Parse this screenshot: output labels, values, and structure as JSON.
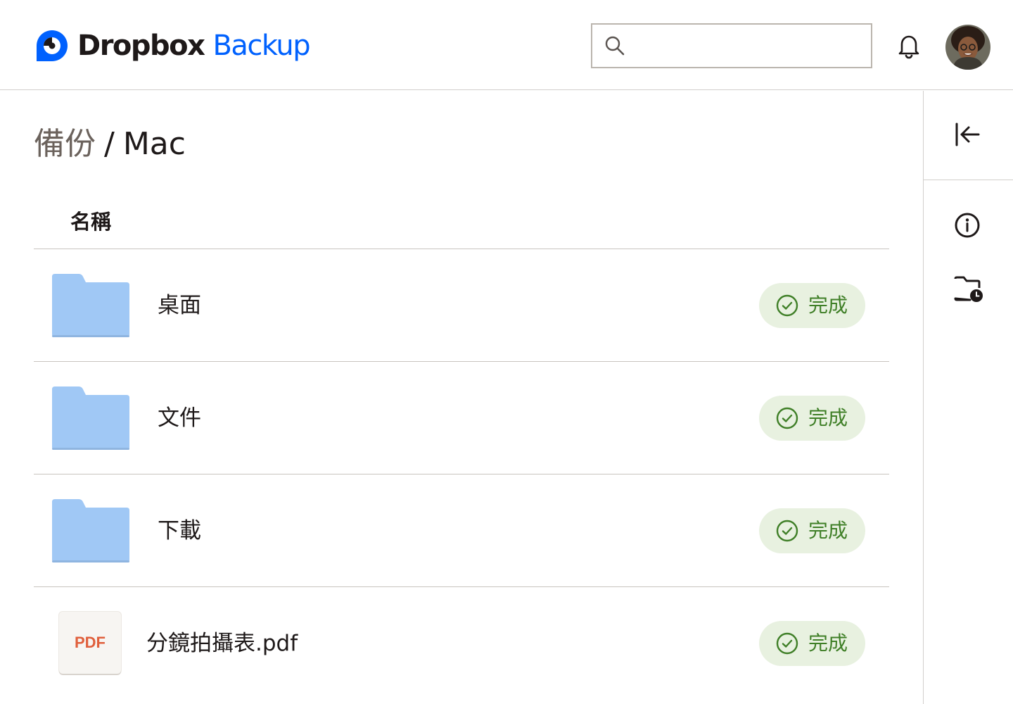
{
  "header": {
    "brand": "Dropbox",
    "product": "Backup",
    "search": {
      "value": "",
      "placeholder": ""
    },
    "icons": {
      "logo": "dropbox-logo-icon",
      "search": "search-icon",
      "notifications": "bell-icon",
      "avatar": "user-avatar"
    }
  },
  "breadcrumb": {
    "parent": "備份",
    "separator": "/",
    "current": "Mac"
  },
  "table": {
    "column_name": "名稱",
    "rows": [
      {
        "name": "桌面",
        "type": "folder",
        "status": "完成"
      },
      {
        "name": "文件",
        "type": "folder",
        "status": "完成"
      },
      {
        "name": "下載",
        "type": "folder",
        "status": "完成"
      },
      {
        "name": "分鏡拍攝表.pdf",
        "type": "file",
        "file_badge": "PDF",
        "status": "完成"
      }
    ]
  },
  "rail": {
    "icons": [
      "collapse-left-icon",
      "info-icon",
      "folder-history-icon"
    ]
  },
  "colors": {
    "brand_blue": "#0061fe",
    "folder_blue": "#a0c8f5",
    "status_green": "#3f7f27",
    "status_bg": "#e8f1e0",
    "pdf_red": "#e05f3c"
  }
}
